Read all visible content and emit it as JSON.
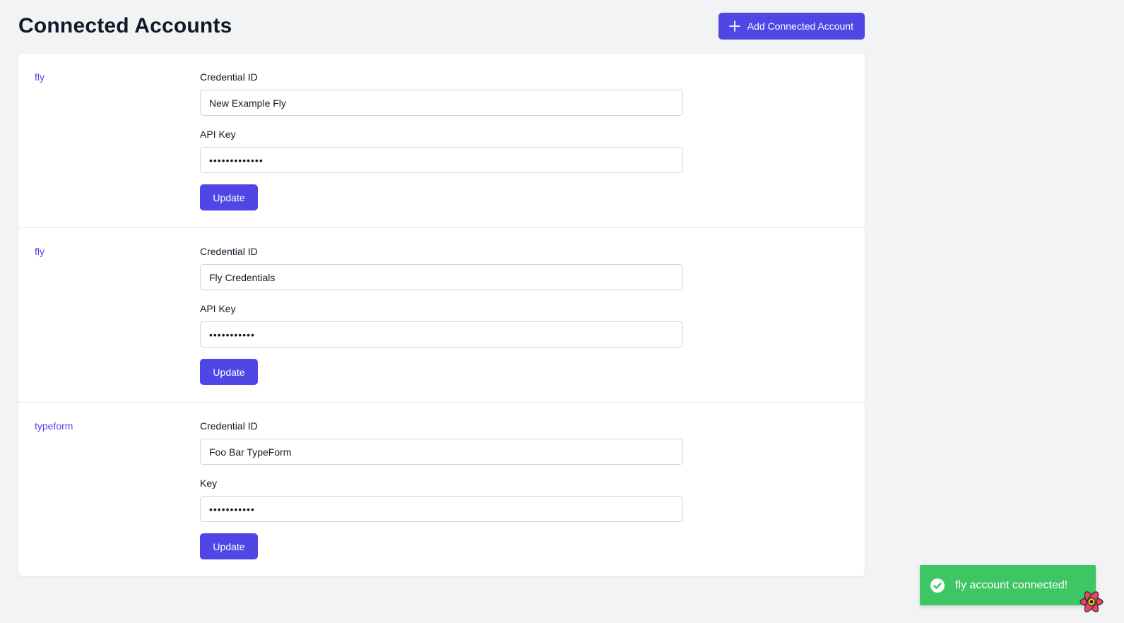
{
  "header": {
    "title": "Connected Accounts",
    "add_button_label": "Add Connected Account",
    "add_button_icon": "plus-icon"
  },
  "accounts": [
    {
      "provider": "fly",
      "credential_label": "Credential ID",
      "credential_value": "New Example Fly",
      "key_label": "API Key",
      "key_value": "•••••••••••••",
      "update_label": "Update"
    },
    {
      "provider": "fly",
      "credential_label": "Credential ID",
      "credential_value": "Fly Credentials",
      "key_label": "API Key",
      "key_value": "•••••••••••",
      "update_label": "Update"
    },
    {
      "provider": "typeform",
      "credential_label": "Credential ID",
      "credential_value": "Foo Bar TypeForm",
      "key_label": "Key",
      "key_value": "•••••••••••",
      "update_label": "Update"
    }
  ],
  "toast": {
    "message": "fly account connected!",
    "icon": "check-circle-icon",
    "color": "#3ec564"
  },
  "colors": {
    "accent": "#4f46e5",
    "background": "#f2f3f5"
  }
}
